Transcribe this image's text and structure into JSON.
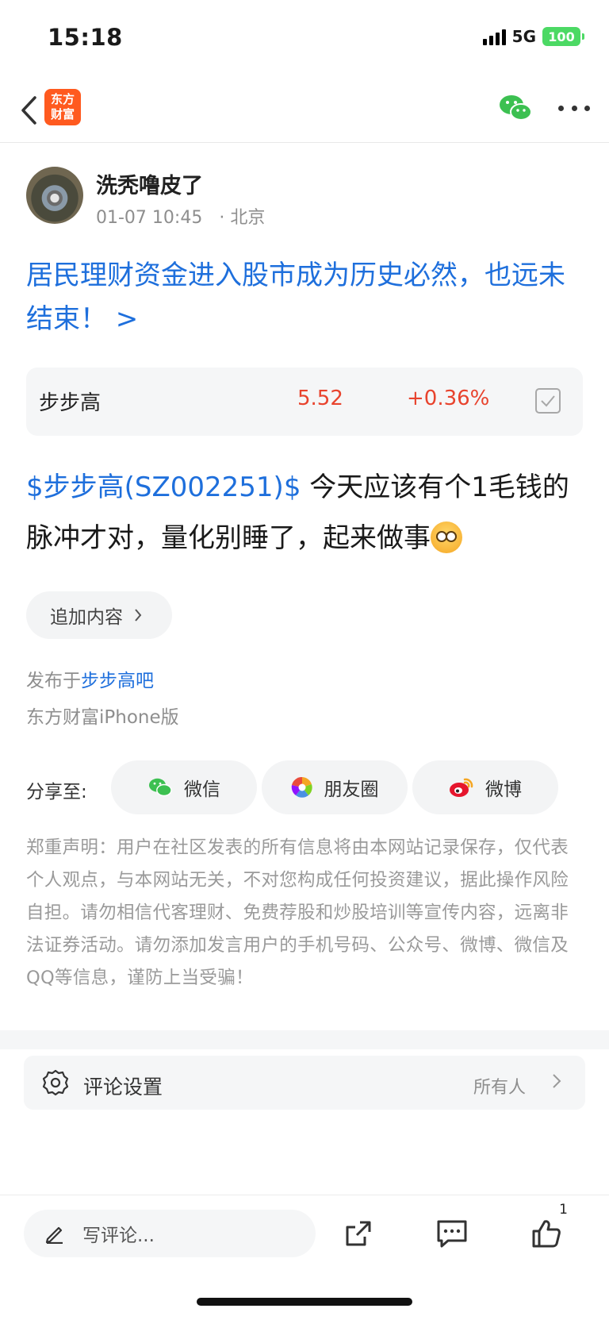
{
  "status_bar": {
    "time": "15:18",
    "network": "5G",
    "battery": "100"
  },
  "nav": {
    "logo_line1": "东方",
    "logo_line2": "财富"
  },
  "author": {
    "name": "洗秃噜皮了",
    "time": "01-07 10:45",
    "location": "· 北京"
  },
  "headline": "居民理财资金进入股市成为历史必然，也远未结束！ >",
  "stock_card": {
    "name": "步步高",
    "price": "5.52",
    "change": "+0.36%"
  },
  "post": {
    "stock_tag": "$步步高(SZ002251)$",
    "text": " 今天应该有个1毛钱的脉冲才对，量化别睡了，起来做事"
  },
  "append_button": {
    "label": "追加内容"
  },
  "meta": {
    "posted_in_prefix": "发布于",
    "bar_name": "步步高吧",
    "device": "东方财富iPhone版"
  },
  "share": {
    "label": "分享至:",
    "buttons": [
      {
        "label": "微信",
        "icon": "wechat-icon"
      },
      {
        "label": "朋友圈",
        "icon": "moments-icon"
      },
      {
        "label": "微博",
        "icon": "weibo-icon"
      }
    ]
  },
  "disclaimer": "郑重声明：用户在社区发表的所有信息将由本网站记录保存，仅代表个人观点，与本网站无关，不对您构成任何投资建议，据此操作风险自担。请勿相信代客理财、免费荐股和炒股培训等宣传内容，远离非法证券活动。请勿添加发言用户的手机号码、公众号、微博、微信及QQ等信息，谨防上当受骗！",
  "comment_settings": {
    "label": "评论设置",
    "value": "所有人"
  },
  "bottom_bar": {
    "comment_placeholder": "写评论...",
    "like_count": "1"
  },
  "colors": {
    "link_blue": "#1e6fdc",
    "stock_red": "#e8432d",
    "brand_orange": "#ff5a1f",
    "wechat_green": "#3cc051"
  }
}
